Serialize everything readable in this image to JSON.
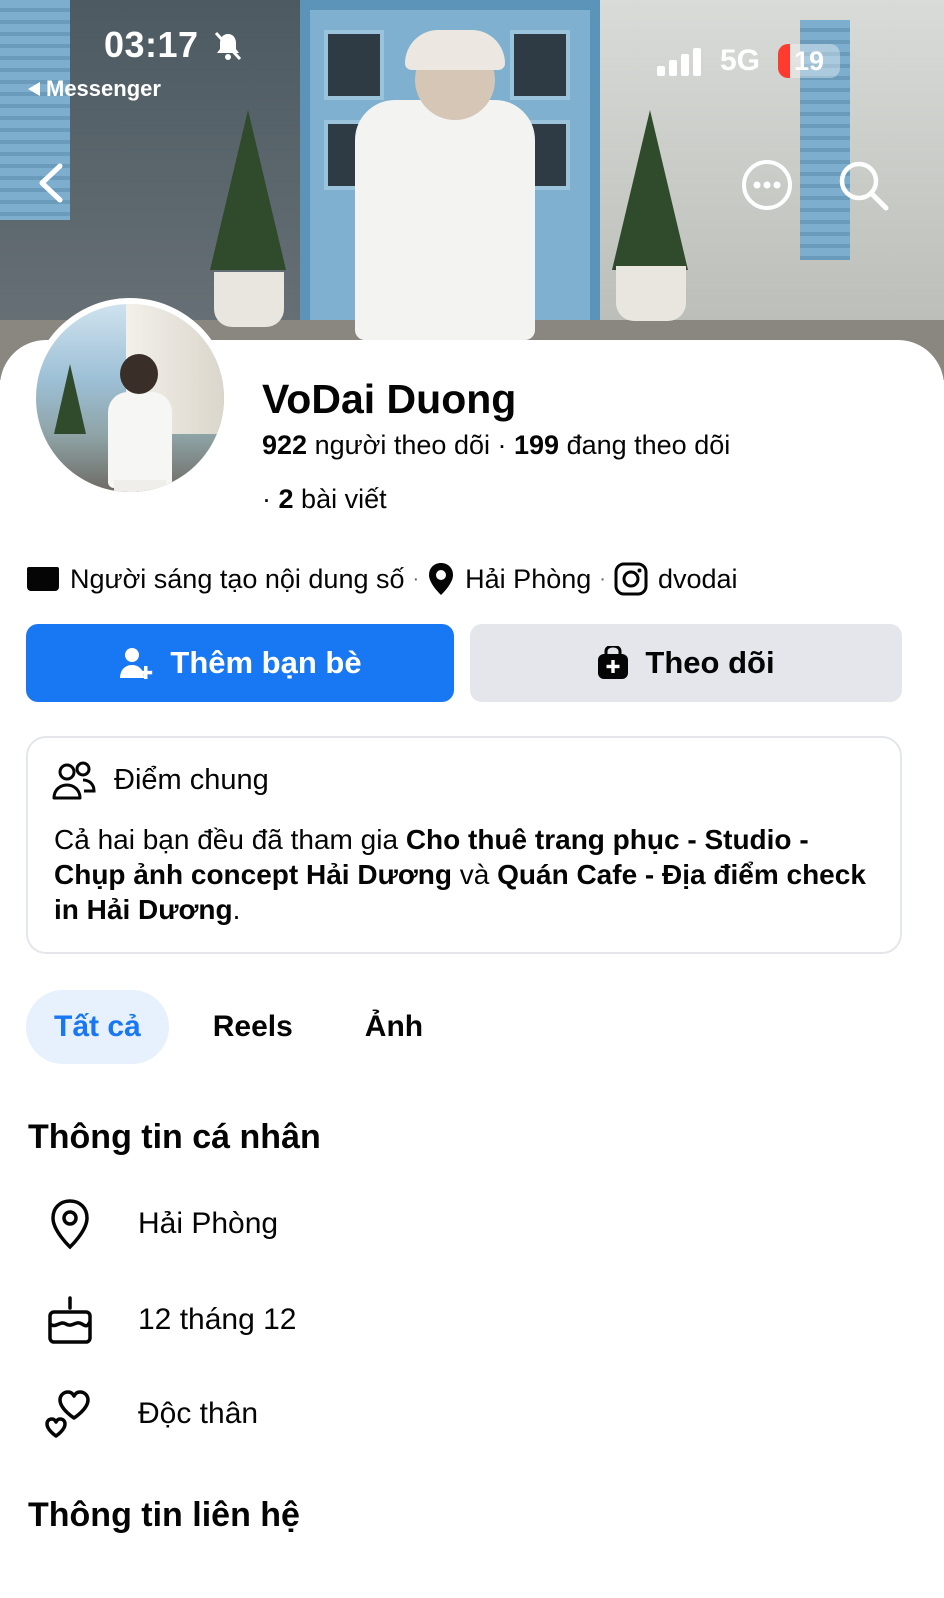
{
  "status_bar": {
    "time": "03:17",
    "back_app": "Messenger",
    "network": "5G",
    "battery": "19",
    "battery_level": 0.19,
    "battery_color": "#ff3b30"
  },
  "nav": {
    "back_icon": "chevron-left-icon",
    "more_icon": "more-horizontal-icon",
    "search_icon": "search-icon"
  },
  "profile": {
    "name": "VoDai Duong",
    "followers_count": "922",
    "followers_label": "người theo dõi",
    "following_count": "199",
    "following_label": "đang theo dõi",
    "posts_count": "2",
    "posts_label": "bài viết",
    "category": "Người sáng tạo nội dung số",
    "location": "Hải Phòng",
    "instagram": "dvodai"
  },
  "actions": {
    "add_friend": "Thêm bạn bè",
    "follow": "Theo dõi",
    "accent_color": "#1877f2"
  },
  "mutual": {
    "title": "Điểm chung",
    "text_prefix": "Cả hai bạn đều đã tham gia ",
    "group_1": "Cho thuê trang phục - Studio - Chụp ảnh concept Hải Dương",
    "text_middle": " và ",
    "group_2": "Quán Cafe - Địa điểm check in Hải Dương",
    "text_suffix": "."
  },
  "tabs": [
    {
      "label": "Tất cả",
      "active": true
    },
    {
      "label": "Reels",
      "active": false
    },
    {
      "label": "Ảnh",
      "active": false
    }
  ],
  "personal_info": {
    "title": "Thông tin cá nhân",
    "items": [
      {
        "icon": "location-pin-icon",
        "value": "Hải Phòng"
      },
      {
        "icon": "birthday-cake-icon",
        "value": "12 tháng 12"
      },
      {
        "icon": "hearts-icon",
        "value": "Độc thân"
      }
    ]
  },
  "contact_info": {
    "title": "Thông tin liên hệ"
  }
}
